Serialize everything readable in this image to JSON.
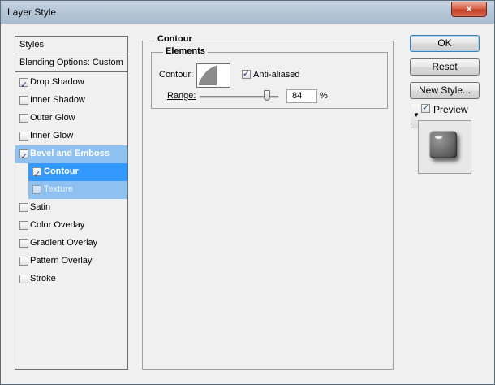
{
  "window": {
    "title": "Layer Style",
    "close_glyph": "×"
  },
  "styles_list": {
    "header": "Styles",
    "blending": "Blending Options: Custom",
    "items": [
      {
        "label": "Drop Shadow",
        "checked": true
      },
      {
        "label": "Inner Shadow",
        "checked": false
      },
      {
        "label": "Outer Glow",
        "checked": false
      },
      {
        "label": "Inner Glow",
        "checked": false
      },
      {
        "label": "Bevel and Emboss",
        "checked": true
      },
      {
        "label": "Contour",
        "checked": true
      },
      {
        "label": "Texture",
        "checked": false
      },
      {
        "label": "Satin",
        "checked": false
      },
      {
        "label": "Color Overlay",
        "checked": false
      },
      {
        "label": "Gradient Overlay",
        "checked": false
      },
      {
        "label": "Pattern Overlay",
        "checked": false
      },
      {
        "label": "Stroke",
        "checked": false
      }
    ]
  },
  "contour_panel": {
    "group_title": "Contour",
    "elements_title": "Elements",
    "contour_label": "Contour:",
    "anti_aliased_label": "Anti-aliased",
    "anti_aliased_checked": true,
    "range_label": "Range:",
    "range_value": "84",
    "range_unit": "%"
  },
  "buttons": {
    "ok": "OK",
    "reset": "Reset",
    "new_style": "New Style..."
  },
  "preview": {
    "label": "Preview",
    "checked": true
  },
  "colors": {
    "selection_active": "#3399ff",
    "selection_parent": "#8ec0f0"
  }
}
